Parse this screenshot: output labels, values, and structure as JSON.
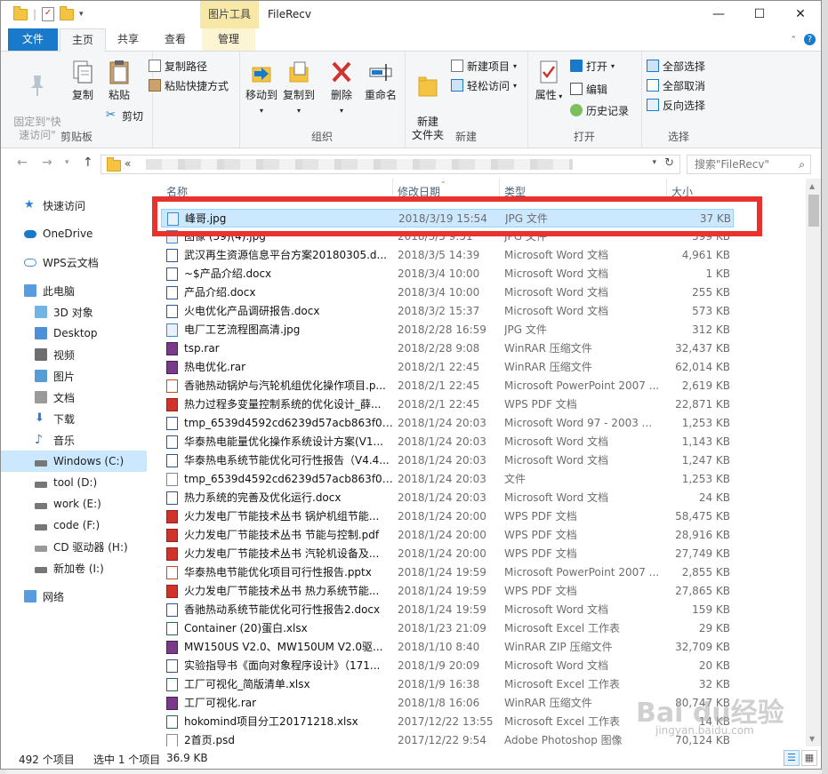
{
  "window": {
    "title": "FileRecv",
    "contextual_tab": "图片工具",
    "buttons": {
      "minimize": "—",
      "maximize": "☐",
      "close": "✕"
    }
  },
  "ribbon_tabs": {
    "file": "文件",
    "home": "主页",
    "share": "共享",
    "view": "查看",
    "manage": "管理"
  },
  "ribbon": {
    "clipboard": {
      "pin": "固定到\"快\n速访问\"",
      "copy": "复制",
      "paste": "粘贴",
      "copy_path": "复制路径",
      "paste_shortcut": "粘贴快捷方式",
      "cut": "剪切",
      "label": "剪贴板"
    },
    "organize": {
      "move_to": "移动到",
      "copy_to": "复制到",
      "delete": "删除",
      "rename": "重命名",
      "label": "组织"
    },
    "new": {
      "new_folder": "新建\n文件夹",
      "new_item": "新建项目",
      "easy_access": "轻松访问",
      "label": "新建"
    },
    "open": {
      "properties": "属性",
      "open": "打开",
      "edit": "编辑",
      "history": "历史记录",
      "label": "打开"
    },
    "select": {
      "select_all": "全部选择",
      "select_none": "全部取消",
      "invert": "反向选择",
      "label": "选择"
    }
  },
  "address": {
    "prefix": "«",
    "search_placeholder": "搜索\"FileRecv\""
  },
  "nav": [
    {
      "label": "快速访问",
      "icon": "star-icon"
    },
    {
      "label": "OneDrive",
      "icon": "cloud-icon"
    },
    {
      "label": "WPS云文档",
      "icon": "cloud-outline-icon"
    },
    {
      "label": "此电脑",
      "icon": "computer-icon"
    },
    {
      "label": "3D 对象",
      "icon": "cube-icon"
    },
    {
      "label": "Desktop",
      "icon": "desktop-icon"
    },
    {
      "label": "视频",
      "icon": "video-icon"
    },
    {
      "label": "图片",
      "icon": "picture-icon"
    },
    {
      "label": "文档",
      "icon": "document-icon"
    },
    {
      "label": "下载",
      "icon": "download-icon"
    },
    {
      "label": "音乐",
      "icon": "music-icon"
    },
    {
      "label": "Windows (C:)",
      "icon": "drive-icon"
    },
    {
      "label": "tool (D:)",
      "icon": "drive-icon"
    },
    {
      "label": "work (E:)",
      "icon": "drive-icon"
    },
    {
      "label": "code (F:)",
      "icon": "drive-icon"
    },
    {
      "label": "CD 驱动器 (H:)",
      "icon": "cd-drive-icon"
    },
    {
      "label": "新加卷 (I:)",
      "icon": "drive-icon"
    },
    {
      "label": "网络",
      "icon": "network-icon"
    }
  ],
  "columns": {
    "name": "名称",
    "date": "修改日期",
    "type": "类型",
    "size": "大小"
  },
  "files": [
    {
      "name": "峰哥.jpg",
      "date": "2018/3/19 15:54",
      "type": "JPG 文件",
      "size": "37 KB",
      "kind": "jpg"
    },
    {
      "name": "图像 (39)(4).jpg",
      "date": "2018/3/5 9:51",
      "type": "JPG 文件",
      "size": "599 KB",
      "kind": "jpg"
    },
    {
      "name": "武汉再生资源信息平台方案20180305.d...",
      "date": "2018/3/5 14:39",
      "type": "Microsoft Word 文档",
      "size": "4,961 KB",
      "kind": "word"
    },
    {
      "name": "~$产品介绍.docx",
      "date": "2018/3/4 10:00",
      "type": "Microsoft Word 文档",
      "size": "1 KB",
      "kind": "word"
    },
    {
      "name": "产品介绍.docx",
      "date": "2018/3/4 10:00",
      "type": "Microsoft Word 文档",
      "size": "255 KB",
      "kind": "word"
    },
    {
      "name": "火电优化产品调研报告.docx",
      "date": "2018/3/2 15:37",
      "type": "Microsoft Word 文档",
      "size": "573 KB",
      "kind": "word"
    },
    {
      "name": "电厂工艺流程图高清.jpg",
      "date": "2018/2/28 16:59",
      "type": "JPG 文件",
      "size": "312 KB",
      "kind": "jpg"
    },
    {
      "name": "tsp.rar",
      "date": "2018/2/28 9:08",
      "type": "WinRAR 压缩文件",
      "size": "32,437 KB",
      "kind": "rar"
    },
    {
      "name": "热电优化.rar",
      "date": "2018/2/1 22:45",
      "type": "WinRAR 压缩文件",
      "size": "62,014 KB",
      "kind": "rar"
    },
    {
      "name": "香驰热动锅炉与汽轮机组优化操作项目.p...",
      "date": "2018/2/1 22:45",
      "type": "Microsoft PowerPoint 2007 ...",
      "size": "2,619 KB",
      "kind": "ppt"
    },
    {
      "name": "热力过程多变量控制系统的优化设计_薛...",
      "date": "2018/2/1 22:45",
      "type": "WPS PDF 文档",
      "size": "22,871 KB",
      "kind": "pdf"
    },
    {
      "name": "tmp_6539d4592cd6239d57acb863f0d...",
      "date": "2018/1/24 20:03",
      "type": "Microsoft Word 97 - 2003 ...",
      "size": "1,253 KB",
      "kind": "word"
    },
    {
      "name": "华泰热电能量优化操作系统设计方案(V1...",
      "date": "2018/1/24 20:03",
      "type": "Microsoft Word 文档",
      "size": "1,143 KB",
      "kind": "word"
    },
    {
      "name": "华泰热电系统节能优化可行性报告（V4.4...",
      "date": "2018/1/24 20:03",
      "type": "Microsoft Word 文档",
      "size": "1,247 KB",
      "kind": "word"
    },
    {
      "name": "tmp_6539d4592cd6239d57acb863f0d...",
      "date": "2018/1/24 20:03",
      "type": "文件",
      "size": "1,253 KB",
      "kind": "blank"
    },
    {
      "name": "热力系统的完善及优化运行.docx",
      "date": "2018/1/24 20:03",
      "type": "Microsoft Word 文档",
      "size": "24 KB",
      "kind": "word"
    },
    {
      "name": "火力发电厂节能技术丛书 锅炉机组节能...",
      "date": "2018/1/24 20:00",
      "type": "WPS PDF 文档",
      "size": "58,475 KB",
      "kind": "pdf"
    },
    {
      "name": "火力发电厂节能技术丛书 节能与控制.pdf",
      "date": "2018/1/24 20:00",
      "type": "WPS PDF 文档",
      "size": "28,916 KB",
      "kind": "pdf"
    },
    {
      "name": "火力发电厂节能技术丛书 汽轮机设备及...",
      "date": "2018/1/24 20:00",
      "type": "WPS PDF 文档",
      "size": "27,749 KB",
      "kind": "pdf"
    },
    {
      "name": "华泰热电节能优化项目可行性报告.pptx",
      "date": "2018/1/24 19:59",
      "type": "Microsoft PowerPoint 2007 ...",
      "size": "2,855 KB",
      "kind": "ppt"
    },
    {
      "name": "火力发电厂节能技术丛书 热力系统节能...",
      "date": "2018/1/24 19:59",
      "type": "WPS PDF 文档",
      "size": "27,865 KB",
      "kind": "pdf"
    },
    {
      "name": "香驰热动系统节能优化可行性报告2.docx",
      "date": "2018/1/24 19:59",
      "type": "Microsoft Word 文档",
      "size": "159 KB",
      "kind": "word"
    },
    {
      "name": "Container (20)蛋白.xlsx",
      "date": "2018/1/23 21:09",
      "type": "Microsoft Excel 工作表",
      "size": "29 KB",
      "kind": "excel"
    },
    {
      "name": "MW150US V2.0、MW150UM V2.0驱...",
      "date": "2018/1/10 8:40",
      "type": "WinRAR ZIP 压缩文件",
      "size": "32,709 KB",
      "kind": "rar"
    },
    {
      "name": "实验指导书《面向对象程序设计》（171...",
      "date": "2018/1/9 20:09",
      "type": "Microsoft Word 文档",
      "size": "20 KB",
      "kind": "word"
    },
    {
      "name": "工厂可视化_简版清单.xlsx",
      "date": "2018/1/9 16:38",
      "type": "Microsoft Excel 工作表",
      "size": "32 KB",
      "kind": "excel"
    },
    {
      "name": "工厂可视化.rar",
      "date": "2018/1/8 16:06",
      "type": "WinRAR 压缩文件",
      "size": "80,747 KB",
      "kind": "rar"
    },
    {
      "name": "hokomind项目分工20171218.xlsx",
      "date": "2017/12/22 13:55",
      "type": "Microsoft Excel 工作表",
      "size": "14 KB",
      "kind": "excel"
    },
    {
      "name": "2首页.psd",
      "date": "2017/12/22 9:54",
      "type": "Adobe Photoshop 图像",
      "size": "70,124 KB",
      "kind": "blank"
    }
  ],
  "status": {
    "count": "492 个项目",
    "selected": "选中 1 个项目",
    "size": "36.9 KB"
  },
  "watermark": {
    "logo": "Bai du经验",
    "url": "jingyan.baidu.com"
  },
  "colors": {
    "accent": "#1979ca",
    "selection": "#cce8ff",
    "highlight": "#e8322e",
    "contextual": "#f7e8a8"
  }
}
